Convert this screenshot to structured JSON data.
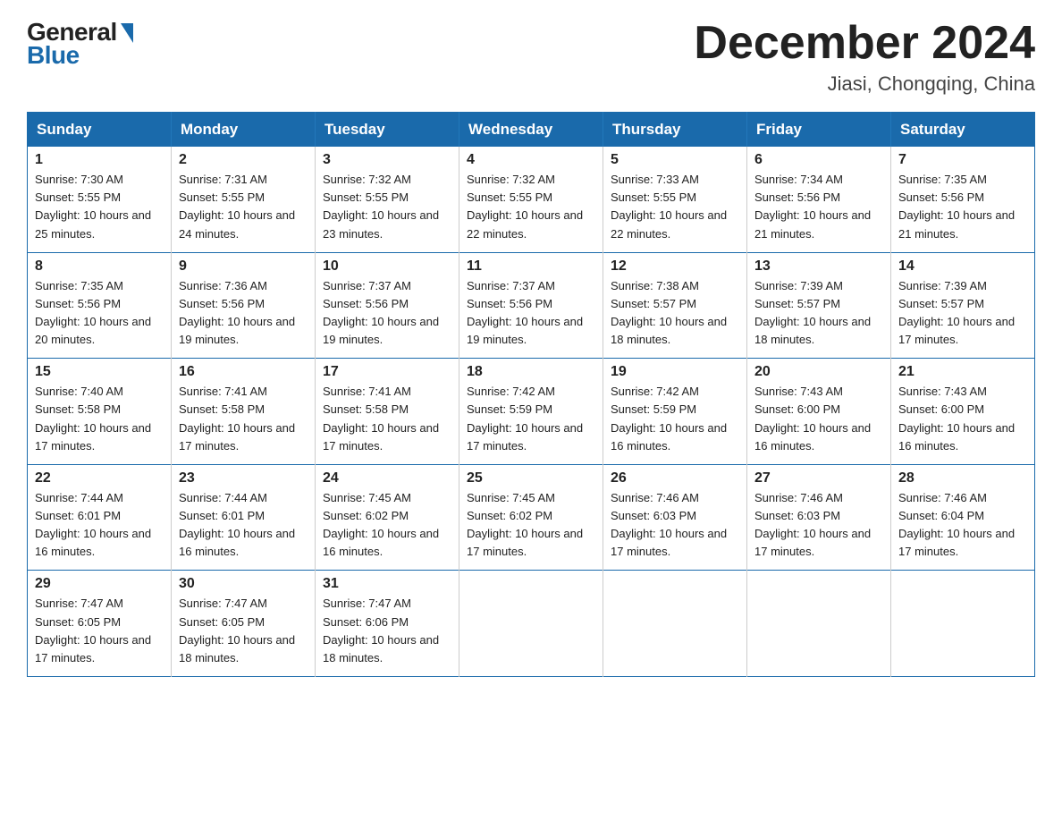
{
  "logo": {
    "general": "General",
    "blue": "Blue"
  },
  "title": "December 2024",
  "subtitle": "Jiasi, Chongqing, China",
  "days_of_week": [
    "Sunday",
    "Monday",
    "Tuesday",
    "Wednesday",
    "Thursday",
    "Friday",
    "Saturday"
  ],
  "weeks": [
    [
      {
        "day": "1",
        "sunrise": "7:30 AM",
        "sunset": "5:55 PM",
        "daylight": "10 hours and 25 minutes."
      },
      {
        "day": "2",
        "sunrise": "7:31 AM",
        "sunset": "5:55 PM",
        "daylight": "10 hours and 24 minutes."
      },
      {
        "day": "3",
        "sunrise": "7:32 AM",
        "sunset": "5:55 PM",
        "daylight": "10 hours and 23 minutes."
      },
      {
        "day": "4",
        "sunrise": "7:32 AM",
        "sunset": "5:55 PM",
        "daylight": "10 hours and 22 minutes."
      },
      {
        "day": "5",
        "sunrise": "7:33 AM",
        "sunset": "5:55 PM",
        "daylight": "10 hours and 22 minutes."
      },
      {
        "day": "6",
        "sunrise": "7:34 AM",
        "sunset": "5:56 PM",
        "daylight": "10 hours and 21 minutes."
      },
      {
        "day": "7",
        "sunrise": "7:35 AM",
        "sunset": "5:56 PM",
        "daylight": "10 hours and 21 minutes."
      }
    ],
    [
      {
        "day": "8",
        "sunrise": "7:35 AM",
        "sunset": "5:56 PM",
        "daylight": "10 hours and 20 minutes."
      },
      {
        "day": "9",
        "sunrise": "7:36 AM",
        "sunset": "5:56 PM",
        "daylight": "10 hours and 19 minutes."
      },
      {
        "day": "10",
        "sunrise": "7:37 AM",
        "sunset": "5:56 PM",
        "daylight": "10 hours and 19 minutes."
      },
      {
        "day": "11",
        "sunrise": "7:37 AM",
        "sunset": "5:56 PM",
        "daylight": "10 hours and 19 minutes."
      },
      {
        "day": "12",
        "sunrise": "7:38 AM",
        "sunset": "5:57 PM",
        "daylight": "10 hours and 18 minutes."
      },
      {
        "day": "13",
        "sunrise": "7:39 AM",
        "sunset": "5:57 PM",
        "daylight": "10 hours and 18 minutes."
      },
      {
        "day": "14",
        "sunrise": "7:39 AM",
        "sunset": "5:57 PM",
        "daylight": "10 hours and 17 minutes."
      }
    ],
    [
      {
        "day": "15",
        "sunrise": "7:40 AM",
        "sunset": "5:58 PM",
        "daylight": "10 hours and 17 minutes."
      },
      {
        "day": "16",
        "sunrise": "7:41 AM",
        "sunset": "5:58 PM",
        "daylight": "10 hours and 17 minutes."
      },
      {
        "day": "17",
        "sunrise": "7:41 AM",
        "sunset": "5:58 PM",
        "daylight": "10 hours and 17 minutes."
      },
      {
        "day": "18",
        "sunrise": "7:42 AM",
        "sunset": "5:59 PM",
        "daylight": "10 hours and 17 minutes."
      },
      {
        "day": "19",
        "sunrise": "7:42 AM",
        "sunset": "5:59 PM",
        "daylight": "10 hours and 16 minutes."
      },
      {
        "day": "20",
        "sunrise": "7:43 AM",
        "sunset": "6:00 PM",
        "daylight": "10 hours and 16 minutes."
      },
      {
        "day": "21",
        "sunrise": "7:43 AM",
        "sunset": "6:00 PM",
        "daylight": "10 hours and 16 minutes."
      }
    ],
    [
      {
        "day": "22",
        "sunrise": "7:44 AM",
        "sunset": "6:01 PM",
        "daylight": "10 hours and 16 minutes."
      },
      {
        "day": "23",
        "sunrise": "7:44 AM",
        "sunset": "6:01 PM",
        "daylight": "10 hours and 16 minutes."
      },
      {
        "day": "24",
        "sunrise": "7:45 AM",
        "sunset": "6:02 PM",
        "daylight": "10 hours and 16 minutes."
      },
      {
        "day": "25",
        "sunrise": "7:45 AM",
        "sunset": "6:02 PM",
        "daylight": "10 hours and 17 minutes."
      },
      {
        "day": "26",
        "sunrise": "7:46 AM",
        "sunset": "6:03 PM",
        "daylight": "10 hours and 17 minutes."
      },
      {
        "day": "27",
        "sunrise": "7:46 AM",
        "sunset": "6:03 PM",
        "daylight": "10 hours and 17 minutes."
      },
      {
        "day": "28",
        "sunrise": "7:46 AM",
        "sunset": "6:04 PM",
        "daylight": "10 hours and 17 minutes."
      }
    ],
    [
      {
        "day": "29",
        "sunrise": "7:47 AM",
        "sunset": "6:05 PM",
        "daylight": "10 hours and 17 minutes."
      },
      {
        "day": "30",
        "sunrise": "7:47 AM",
        "sunset": "6:05 PM",
        "daylight": "10 hours and 18 minutes."
      },
      {
        "day": "31",
        "sunrise": "7:47 AM",
        "sunset": "6:06 PM",
        "daylight": "10 hours and 18 minutes."
      },
      null,
      null,
      null,
      null
    ]
  ]
}
